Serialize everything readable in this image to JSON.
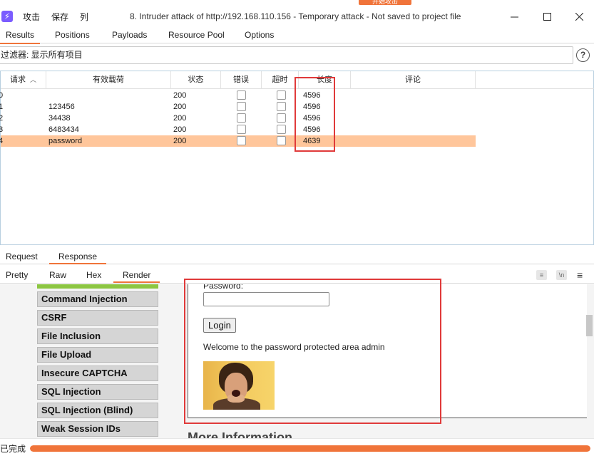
{
  "top_button": {
    "label": "开始攻击"
  },
  "menu": {
    "items": [
      "攻击",
      "保存",
      "列"
    ]
  },
  "window": {
    "title": "8. Intruder attack of http://192.168.110.156 - Temporary attack - Not saved to project file"
  },
  "tabs": [
    "Results",
    "Positions",
    "Payloads",
    "Resource Pool",
    "Options"
  ],
  "filter": {
    "text": "过滤器: 显示所有项目",
    "help": "?"
  },
  "table": {
    "headers": [
      "请求",
      "有效载荷",
      "状态",
      "错误",
      "超时",
      "长度",
      "评论"
    ],
    "sort_indicator": "^",
    "rows": [
      {
        "request": "0",
        "payload": "",
        "status": "200",
        "length": "4596",
        "selected": false
      },
      {
        "request": "1",
        "payload": "123456",
        "status": "200",
        "length": "4596",
        "selected": false
      },
      {
        "request": "2",
        "payload": "34438",
        "status": "200",
        "length": "4596",
        "selected": false
      },
      {
        "request": "3",
        "payload": "6483434",
        "status": "200",
        "length": "4596",
        "selected": false
      },
      {
        "request": "4",
        "payload": "password",
        "status": "200",
        "length": "4639",
        "selected": true
      }
    ]
  },
  "rr_tabs": [
    "Request",
    "Response"
  ],
  "view_tabs": [
    "Pretty",
    "Raw",
    "Hex",
    "Render"
  ],
  "view_icons": [
    "wrap-icon",
    "newline-icon",
    "menu-icon"
  ],
  "render": {
    "menu_items": [
      "Command Injection",
      "CSRF",
      "File Inclusion",
      "File Upload",
      "Insecure CAPTCHA",
      "SQL Injection",
      "SQL Injection (Blind)",
      "Weak Session IDs"
    ],
    "password_label": "Password:",
    "login_button": "Login",
    "welcome_text": "Welcome to the password protected area admin",
    "more_info": "More Information"
  },
  "status": {
    "text": "已完成",
    "progress": 1.0
  },
  "colors": {
    "accent": "#f0743a",
    "selected_row": "#ffc69b",
    "highlight_box": "#e03a3a"
  }
}
